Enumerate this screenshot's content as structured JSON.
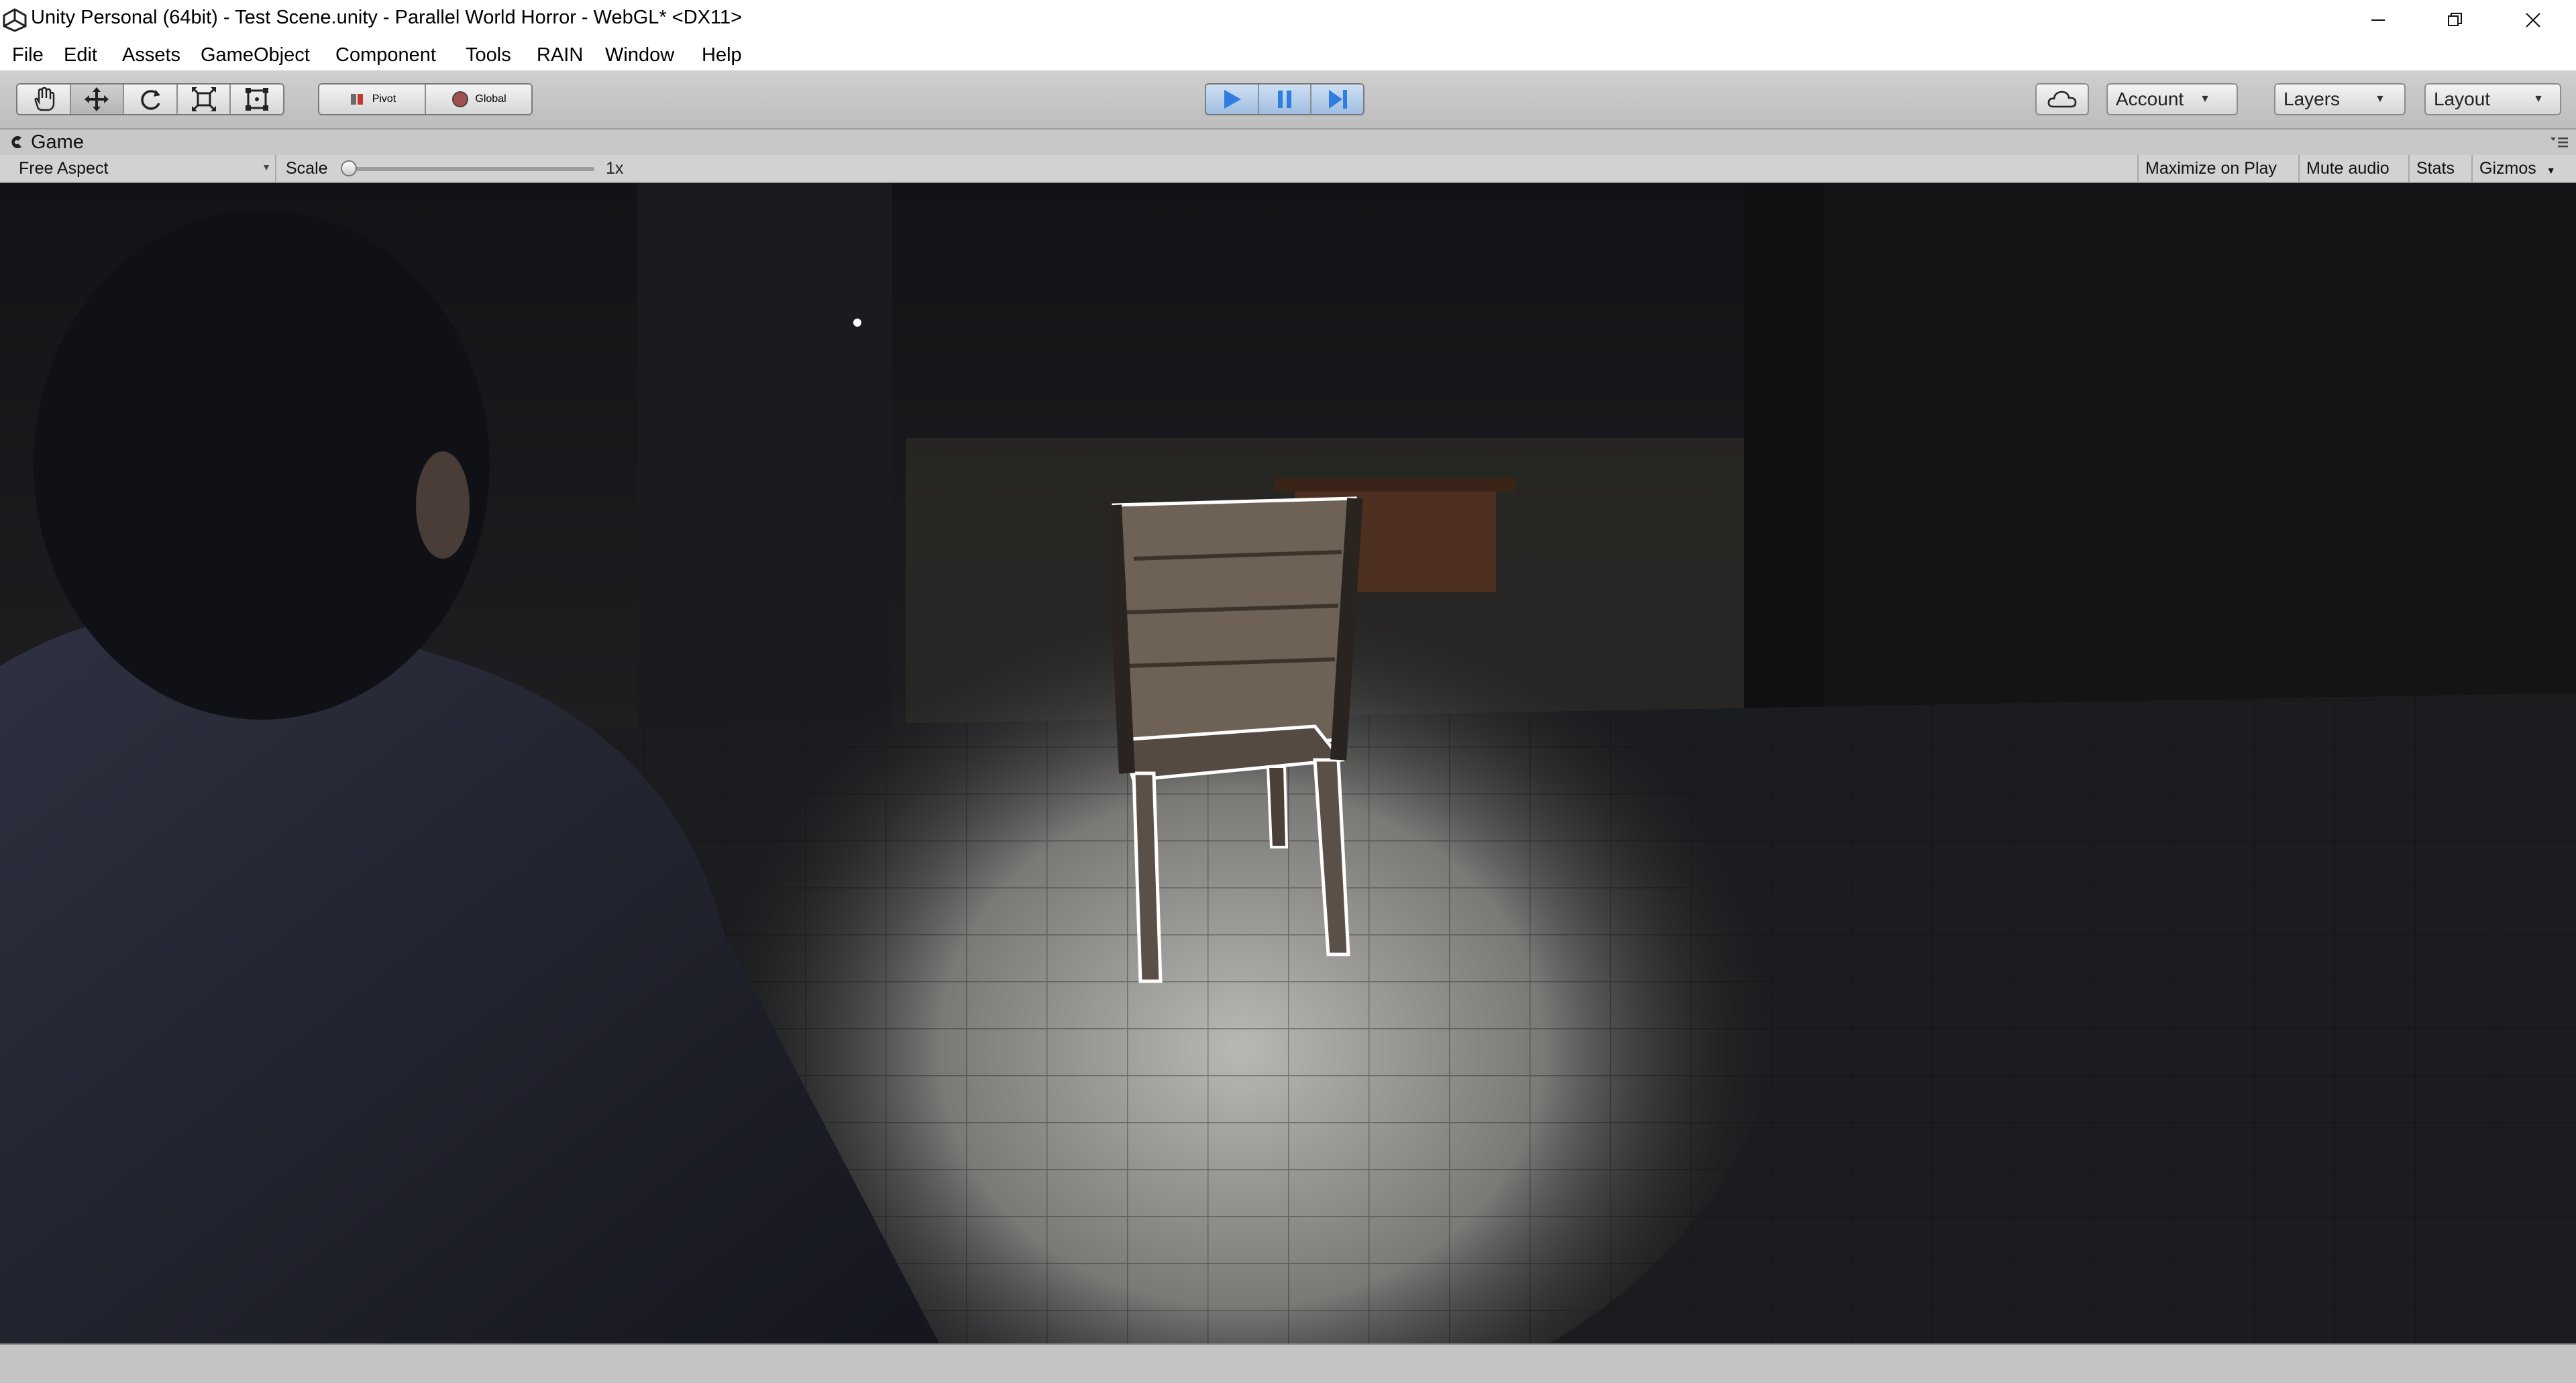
{
  "window": {
    "title": "Unity Personal (64bit) - Test Scene.unity - Parallel World Horror - WebGL* <DX11>",
    "controls": [
      "minimize-icon",
      "restore-icon",
      "close-icon"
    ]
  },
  "menu": {
    "items": [
      "File",
      "Edit",
      "Assets",
      "GameObject",
      "Component",
      "Tools",
      "RAIN",
      "Window",
      "Help"
    ]
  },
  "toolbar": {
    "transform_tools": [
      "hand-tool-icon",
      "move-tool-icon",
      "rotate-tool-icon",
      "scale-tool-icon",
      "rect-tool-icon"
    ],
    "pivot_label": "Pivot",
    "global_label": "Global",
    "playback": [
      "play-icon",
      "pause-icon",
      "step-icon"
    ],
    "account_label": "Account",
    "layers_label": "Layers",
    "layout_label": "Layout"
  },
  "game_view": {
    "tab_label": "Game",
    "aspect": "Free Aspect",
    "scale_label": "Scale",
    "scale_value": "1x",
    "buttons": [
      "Maximize on Play",
      "Mute audio",
      "Stats",
      "Gizmos"
    ]
  },
  "colors": {
    "play_accent": "#2f7de1",
    "chair_outline": "#ffffff",
    "scene_background": "#0f1013"
  }
}
